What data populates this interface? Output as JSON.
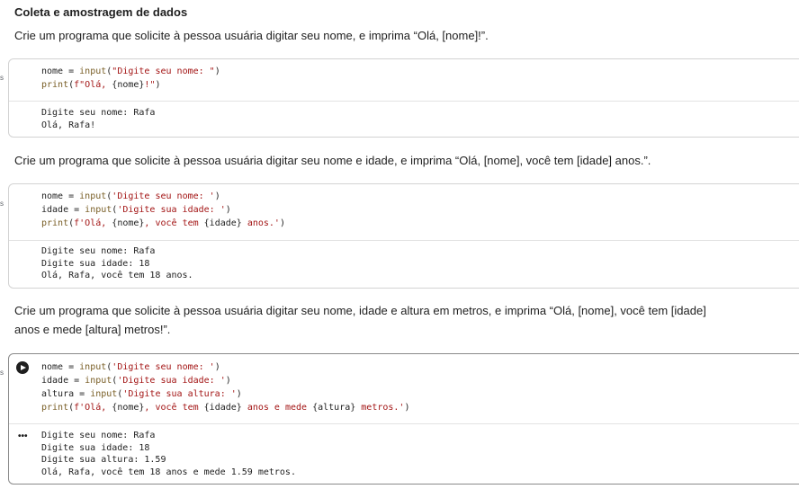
{
  "section_title": "Coleta e amostragem de dados",
  "task1": "Crie um programa que solicite à pessoa usuária digitar seu nome, e imprima “Olá, [nome]!”.",
  "cell1": {
    "line1": [
      "nome",
      " = ",
      "input",
      "(",
      "\"Digite seu nome: \"",
      ")"
    ],
    "line2": [
      "print",
      "(",
      "f\"Olá, ",
      "{nome}",
      "!\"",
      ")"
    ],
    "output": [
      "Digite seu nome: Rafa",
      "Olá, Rafa!"
    ]
  },
  "task2": "Crie um programa que solicite à pessoa usuária digitar seu nome e idade, e imprima “Olá, [nome], você tem [idade] anos.”.",
  "cell2": {
    "line1": [
      "nome",
      " = ",
      "input",
      "(",
      "'Digite seu nome: '",
      ")"
    ],
    "line2": [
      "idade",
      " = ",
      "input",
      "(",
      "'Digite sua idade: '",
      ")"
    ],
    "line3": [
      "print",
      "(",
      "f'Olá, ",
      "{nome}",
      ", você tem ",
      "{idade}",
      " anos.'",
      ")"
    ],
    "output": [
      "Digite seu nome: Rafa",
      "Digite sua idade: 18",
      "Olá, Rafa, você tem 18 anos."
    ]
  },
  "task3_line1": "Crie um programa que solicite à pessoa usuária digitar seu nome, idade e altura em metros, e imprima “Olá, [nome], você tem [idade]",
  "task3_line2": "anos e mede [altura] metros!”.",
  "cell3": {
    "line1": [
      "nome",
      " = ",
      "input",
      "(",
      "'Digite seu nome: '",
      ")"
    ],
    "line2": [
      "idade",
      " = ",
      "input",
      "(",
      "'Digite sua idade: '",
      ")"
    ],
    "line3": [
      "altura",
      " = ",
      "input",
      "(",
      "'Digite sua altura: '",
      ")"
    ],
    "line4": [
      "print",
      "(",
      "f'Olá, ",
      "{nome}",
      ", você tem ",
      "{idade}",
      " anos e mede ",
      "{altura}",
      " metros.'",
      ")"
    ],
    "output": [
      "Digite seu nome: Rafa",
      "Digite sua idade: 18",
      "Digite sua altura: 1.59",
      "Olá, Rafa, você tem 18 anos e mede 1.59 metros."
    ]
  },
  "gutter_mark": "s",
  "output_menu": "•••",
  "icons": {
    "run": "play-circle-icon",
    "output_menu": "more-horiz-icon"
  }
}
